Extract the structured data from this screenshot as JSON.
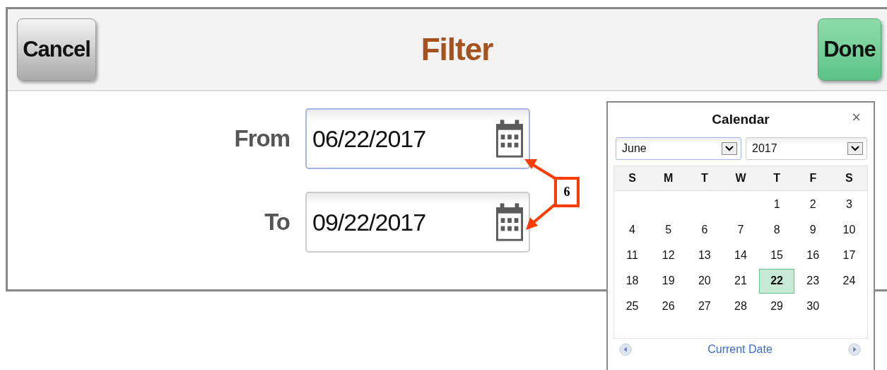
{
  "header": {
    "title": "Filter",
    "cancel_button": "Cancel",
    "done_button": "Done"
  },
  "fields": [
    {
      "label": "From",
      "value": "06/22/2017",
      "focused": true
    },
    {
      "label": "To",
      "value": "09/22/2017",
      "focused": false
    }
  ],
  "calendar": {
    "title": "Calendar",
    "close": "×",
    "month_select": {
      "value": "June",
      "focused": true
    },
    "year_select": {
      "value": "2017",
      "focused": false
    },
    "weekdays": [
      "S",
      "M",
      "T",
      "W",
      "T",
      "F",
      "S"
    ],
    "days": [
      {
        "kind": "blank"
      },
      {
        "kind": "blank"
      },
      {
        "kind": "blank"
      },
      {
        "kind": "blank"
      },
      {
        "kind": "day",
        "label": "1",
        "selected": false
      },
      {
        "kind": "day",
        "label": "2",
        "selected": false
      },
      {
        "kind": "day",
        "label": "3",
        "selected": false
      },
      {
        "kind": "day",
        "label": "4",
        "selected": false
      },
      {
        "kind": "day",
        "label": "5",
        "selected": false
      },
      {
        "kind": "day",
        "label": "6",
        "selected": false
      },
      {
        "kind": "day",
        "label": "7",
        "selected": false
      },
      {
        "kind": "day",
        "label": "8",
        "selected": false
      },
      {
        "kind": "day",
        "label": "9",
        "selected": false
      },
      {
        "kind": "day",
        "label": "10",
        "selected": false
      },
      {
        "kind": "day",
        "label": "11",
        "selected": false
      },
      {
        "kind": "day",
        "label": "12",
        "selected": false
      },
      {
        "kind": "day",
        "label": "13",
        "selected": false
      },
      {
        "kind": "day",
        "label": "14",
        "selected": false
      },
      {
        "kind": "day",
        "label": "15",
        "selected": false
      },
      {
        "kind": "day",
        "label": "16",
        "selected": false
      },
      {
        "kind": "day",
        "label": "17",
        "selected": false
      },
      {
        "kind": "day",
        "label": "18",
        "selected": false
      },
      {
        "kind": "day",
        "label": "19",
        "selected": false
      },
      {
        "kind": "day",
        "label": "20",
        "selected": false
      },
      {
        "kind": "day",
        "label": "21",
        "selected": false
      },
      {
        "kind": "day",
        "label": "22",
        "selected": true
      },
      {
        "kind": "day",
        "label": "23",
        "selected": false
      },
      {
        "kind": "day",
        "label": "24",
        "selected": false
      },
      {
        "kind": "day",
        "label": "25",
        "selected": false
      },
      {
        "kind": "day",
        "label": "26",
        "selected": false
      },
      {
        "kind": "day",
        "label": "27",
        "selected": false
      },
      {
        "kind": "day",
        "label": "28",
        "selected": false
      },
      {
        "kind": "day",
        "label": "29",
        "selected": false
      },
      {
        "kind": "day",
        "label": "30",
        "selected": false
      }
    ],
    "footer_link": "Current Date"
  },
  "annotation": {
    "label": "6"
  }
}
